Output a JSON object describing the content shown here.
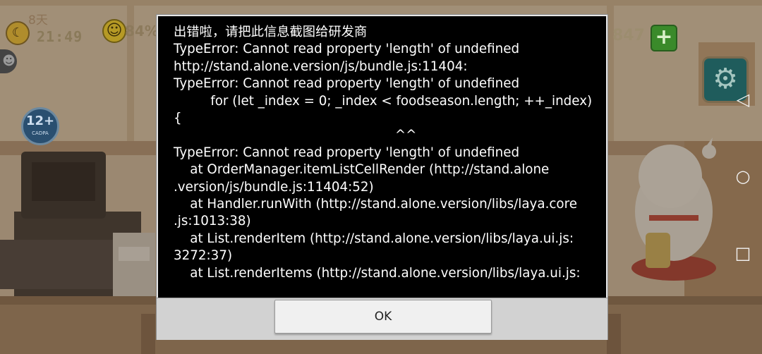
{
  "hud": {
    "day": "8天",
    "time": "21:49",
    "happiness": "84%",
    "coins": "847",
    "age_rating": "12+",
    "age_rating_sub": "CADPA",
    "moon_icon": "moon-icon",
    "smile_icon": "smile-icon",
    "plus_icon": "plus-icon",
    "gear_icon": "gear-icon"
  },
  "dialog": {
    "message": "出错啦，请把此信息截图给研发商\nTypeError: Cannot read property 'length' of undefined\nhttp://stand.alone.version/js/bundle.js:11404:\nTypeError: Cannot read property 'length' of undefined\n         for (let _index = 0; _index < foodseason.length; ++_index)\n{\n                                                      ^^\nTypeError: Cannot read property 'length' of undefined\n    at OrderManager.itemListCellRender (http://stand.alone\n.version/js/bundle.js:11404:52)\n    at Handler.runWith (http://stand.alone.version/libs/laya.core\n.js:1013:38)\n    at List.renderItem (http://stand.alone.version/libs/laya.ui.js:\n3272:37)\n    at List.renderItems (http://stand.alone.version/libs/laya.ui.js:",
    "ok_label": "OK"
  },
  "nav": {
    "back": "◁",
    "home": "○",
    "recent": "□"
  },
  "colors": {
    "dialog_bg": "#000000",
    "dialog_text": "#ffffff",
    "footer_bg": "#d2d2d2"
  }
}
